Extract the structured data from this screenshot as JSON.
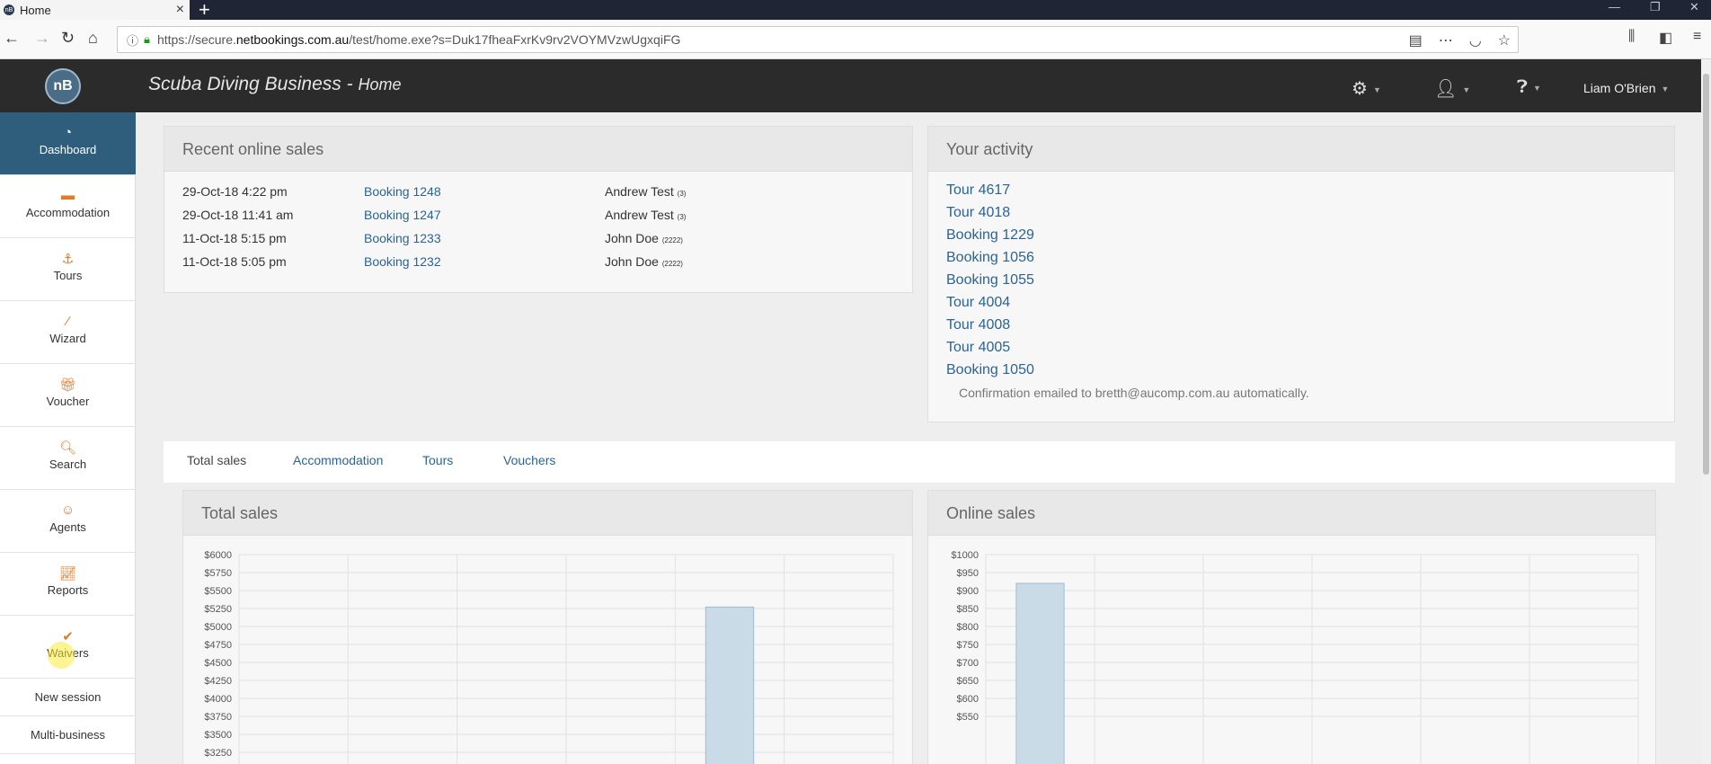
{
  "browser": {
    "tab_title": "Home",
    "favicon_text": "nB",
    "url_host_prefix": "https://secure.",
    "url_host": "netbookings.com.au",
    "url_path": "/test/home.exe?s=Duk17fheaFxrKv9rv2VOYMVzwUgxqiFG"
  },
  "app": {
    "logo_text": "nB",
    "title": "Scuba Diving Business",
    "title_sep": " - ",
    "page": "Home",
    "user": "Liam O'Brien"
  },
  "sidebar": {
    "items": [
      {
        "label": "Dashboard",
        "icon": "dashboard-icon"
      },
      {
        "label": "Accommodation",
        "icon": "bed-icon"
      },
      {
        "label": "Tours",
        "icon": "tours-icon"
      },
      {
        "label": "Wizard",
        "icon": "wand-icon"
      },
      {
        "label": "Voucher",
        "icon": "gift-icon"
      },
      {
        "label": "Search",
        "icon": "search-icon"
      },
      {
        "label": "Agents",
        "icon": "agent-icon"
      },
      {
        "label": "Reports",
        "icon": "chart-icon"
      },
      {
        "label": "Waivers",
        "icon": "check-icon"
      }
    ],
    "plain": [
      "New session",
      "Multi-business"
    ]
  },
  "recent_sales": {
    "title": "Recent online sales",
    "rows": [
      {
        "date": "29-Oct-18 4:22 pm",
        "booking": "Booking 1248",
        "name": "Andrew Test",
        "ref": "(3)"
      },
      {
        "date": "29-Oct-18 11:41 am",
        "booking": "Booking 1247",
        "name": "Andrew Test",
        "ref": "(3)"
      },
      {
        "date": "11-Oct-18 5:15 pm",
        "booking": "Booking 1233",
        "name": "John Doe",
        "ref": "(2222)"
      },
      {
        "date": "11-Oct-18 5:05 pm",
        "booking": "Booking 1232",
        "name": "John Doe",
        "ref": "(2222)"
      }
    ]
  },
  "activity": {
    "title": "Your activity",
    "links": [
      "Tour 4617",
      "Tour 4018",
      "Booking 1229",
      "Booking 1056",
      "Booking 1055",
      "Tour 4004",
      "Tour 4008",
      "Tour 4005",
      "Booking 1050"
    ],
    "note": "Confirmation emailed to bretth@aucomp.com.au automatically."
  },
  "tabs": [
    "Total sales",
    "Accommodation",
    "Tours",
    "Vouchers"
  ],
  "chart_data": [
    {
      "type": "bar",
      "title": "Total sales",
      "yticks": [
        "$6000",
        "$5750",
        "$5500",
        "$5250",
        "$5000",
        "$4750",
        "$4500",
        "$4250",
        "$4000",
        "$3750",
        "$3500",
        "$3250"
      ],
      "visible_ylim": [
        3250,
        6000
      ],
      "bars": [
        {
          "slot": 5,
          "value": 5270
        }
      ],
      "slots": 6,
      "bar_color": "#c9dbe6"
    },
    {
      "type": "bar",
      "title": "Online sales",
      "yticks": [
        "$1000",
        "$950",
        "$900",
        "$850",
        "$800",
        "$750",
        "$700",
        "$650",
        "$600",
        "$550"
      ],
      "visible_ylim": [
        550,
        1000
      ],
      "bars": [
        {
          "slot": 1,
          "value": 920
        }
      ],
      "slots": 6,
      "bar_color": "#c9dbe6"
    }
  ]
}
